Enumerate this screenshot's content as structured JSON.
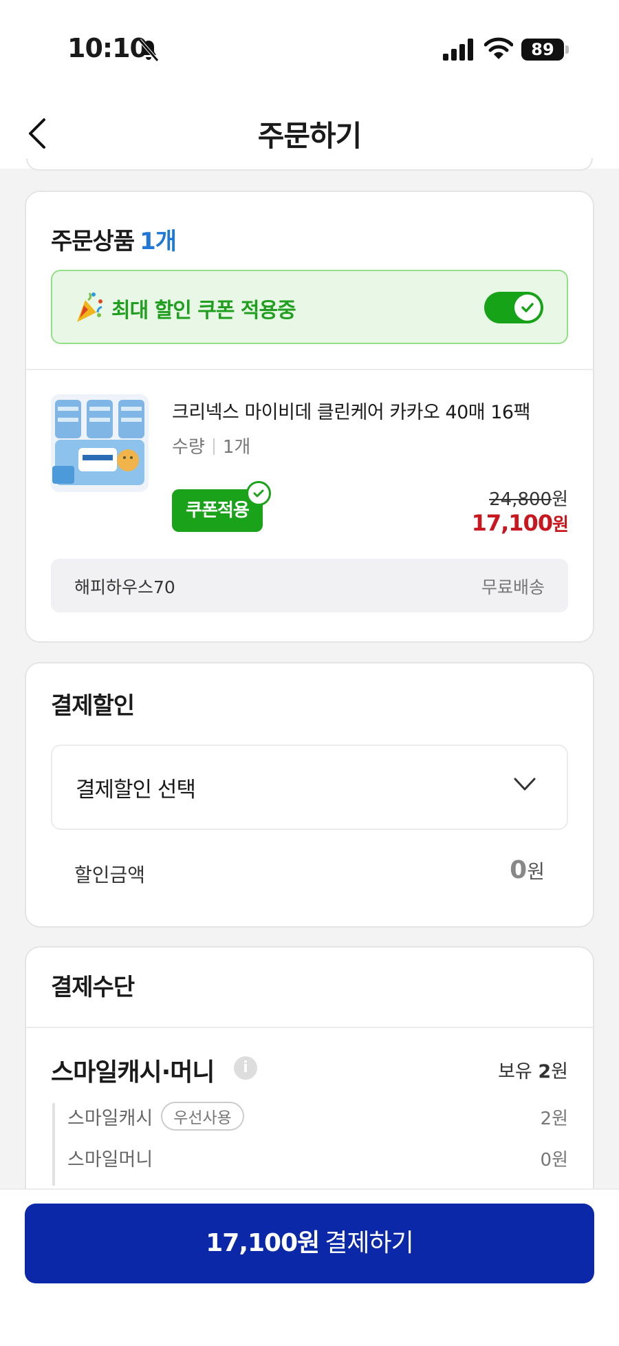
{
  "status_bar": {
    "time": "10:10",
    "battery": "89"
  },
  "header": {
    "title": "주문하기"
  },
  "order_section": {
    "title": "주문상품",
    "count": "1개",
    "coupon_banner": "최대 할인 쿠폰 적용중",
    "coupon_toggle_on": true,
    "product": {
      "name": "크리넥스 마이비데 클린케어 카카오 40매 16팩",
      "qty_label": "수량",
      "qty_value": "1개",
      "coupon_badge": "쿠폰적용",
      "original_price": "24,800",
      "original_unit": "원",
      "sale_price": "17,100",
      "sale_unit": "원"
    },
    "seller": "해피하우스70",
    "shipping": "무료배송"
  },
  "discount_section": {
    "title": "결제할인",
    "select_placeholder": "결제할인 선택",
    "amount_label": "할인금액",
    "amount_value": "0",
    "amount_unit": "원"
  },
  "method_section": {
    "title": "결제수단",
    "smile_title": "스마일캐시·머니",
    "hold_label": "보유",
    "hold_value": "2",
    "hold_unit": "원",
    "items": [
      {
        "label": "스마일캐시",
        "badge": "우선사용",
        "value": "2원"
      },
      {
        "label": "스마일머니",
        "value": "0원"
      }
    ]
  },
  "pay_button": {
    "amount": "17,100원",
    "label": "결제하기"
  },
  "colors": {
    "accent_blue": "#1e78d8",
    "coupon_green": "#1aa31a",
    "sale_red": "#c8171e",
    "pay_button_navy": "#0a28a8"
  }
}
